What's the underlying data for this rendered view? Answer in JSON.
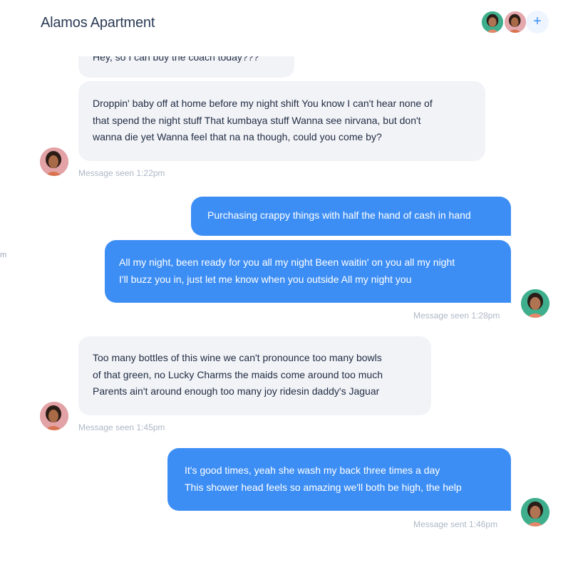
{
  "header": {
    "title": "Alamos Apartment",
    "add_label": "+"
  },
  "side_fragment": "m",
  "messages": [
    {
      "direction": "in",
      "lines": [
        "Hey, so I can buy the coach today???"
      ]
    },
    {
      "direction": "in",
      "lines": [
        "Droppin' baby off at home before my night shift You know I can't hear none of",
        "that spend the night stuff That kumbaya stuff Wanna see nirvana, but don't",
        "wanna die yet Wanna feel that na na though, could you come by?"
      ],
      "meta": "Message seen 1:22pm"
    },
    {
      "direction": "out",
      "lines": [
        "Purchasing crappy things with half the hand of cash in hand"
      ]
    },
    {
      "direction": "out",
      "lines": [
        "All my night, been ready for you all my night Been waitin' on you all my night",
        "I'll buzz you in, just let me know when you outside All my night you"
      ],
      "meta": "Message seen 1:28pm"
    },
    {
      "direction": "in",
      "lines": [
        "Too many bottles of this wine we can't pronounce too many bowls",
        "of that green, no Lucky Charms the maids come around too much",
        "Parents ain't around enough too many joy ridesin daddy's Jaguar"
      ],
      "meta": "Message seen 1:45pm"
    },
    {
      "direction": "out",
      "lines": [
        "It's good times, yeah she wash my back three times a day",
        "This shower head feels so amazing we'll both be high, the help"
      ],
      "meta": "Message sent 1:46pm"
    }
  ],
  "colors": {
    "accent": "#3d8ef4",
    "incoming_bubble": "#f2f3f7",
    "meta_text": "#aeb8c6"
  },
  "icons": {
    "avatar_contact": "woman-avatar-pink",
    "avatar_self": "woman-avatar-green",
    "add": "plus-icon"
  }
}
